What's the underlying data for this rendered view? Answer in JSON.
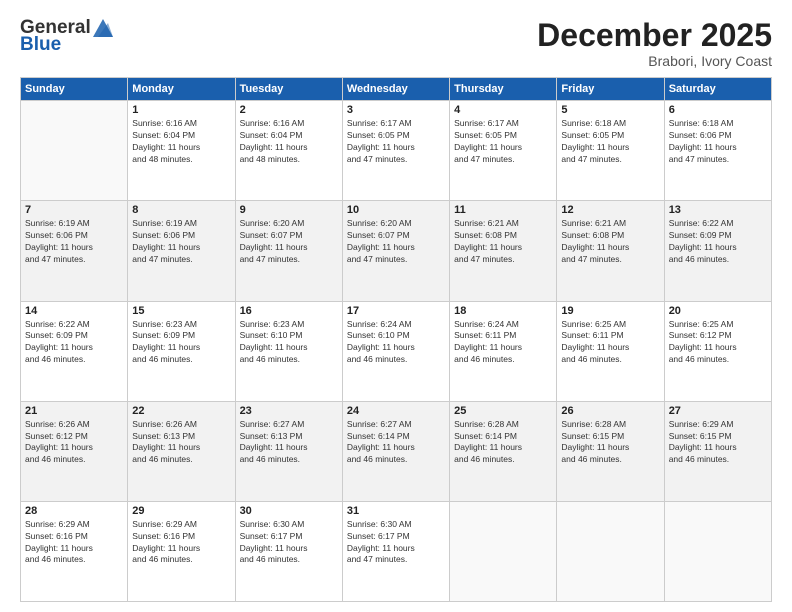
{
  "logo": {
    "general": "General",
    "blue": "Blue"
  },
  "title": "December 2025",
  "location": "Brabori, Ivory Coast",
  "days_of_week": [
    "Sunday",
    "Monday",
    "Tuesday",
    "Wednesday",
    "Thursday",
    "Friday",
    "Saturday"
  ],
  "weeks": [
    [
      {
        "day": "",
        "info": ""
      },
      {
        "day": "1",
        "info": "Sunrise: 6:16 AM\nSunset: 6:04 PM\nDaylight: 11 hours\nand 48 minutes."
      },
      {
        "day": "2",
        "info": "Sunrise: 6:16 AM\nSunset: 6:04 PM\nDaylight: 11 hours\nand 48 minutes."
      },
      {
        "day": "3",
        "info": "Sunrise: 6:17 AM\nSunset: 6:05 PM\nDaylight: 11 hours\nand 47 minutes."
      },
      {
        "day": "4",
        "info": "Sunrise: 6:17 AM\nSunset: 6:05 PM\nDaylight: 11 hours\nand 47 minutes."
      },
      {
        "day": "5",
        "info": "Sunrise: 6:18 AM\nSunset: 6:05 PM\nDaylight: 11 hours\nand 47 minutes."
      },
      {
        "day": "6",
        "info": "Sunrise: 6:18 AM\nSunset: 6:06 PM\nDaylight: 11 hours\nand 47 minutes."
      }
    ],
    [
      {
        "day": "7",
        "info": "Sunrise: 6:19 AM\nSunset: 6:06 PM\nDaylight: 11 hours\nand 47 minutes."
      },
      {
        "day": "8",
        "info": "Sunrise: 6:19 AM\nSunset: 6:06 PM\nDaylight: 11 hours\nand 47 minutes."
      },
      {
        "day": "9",
        "info": "Sunrise: 6:20 AM\nSunset: 6:07 PM\nDaylight: 11 hours\nand 47 minutes."
      },
      {
        "day": "10",
        "info": "Sunrise: 6:20 AM\nSunset: 6:07 PM\nDaylight: 11 hours\nand 47 minutes."
      },
      {
        "day": "11",
        "info": "Sunrise: 6:21 AM\nSunset: 6:08 PM\nDaylight: 11 hours\nand 47 minutes."
      },
      {
        "day": "12",
        "info": "Sunrise: 6:21 AM\nSunset: 6:08 PM\nDaylight: 11 hours\nand 47 minutes."
      },
      {
        "day": "13",
        "info": "Sunrise: 6:22 AM\nSunset: 6:09 PM\nDaylight: 11 hours\nand 46 minutes."
      }
    ],
    [
      {
        "day": "14",
        "info": "Sunrise: 6:22 AM\nSunset: 6:09 PM\nDaylight: 11 hours\nand 46 minutes."
      },
      {
        "day": "15",
        "info": "Sunrise: 6:23 AM\nSunset: 6:09 PM\nDaylight: 11 hours\nand 46 minutes."
      },
      {
        "day": "16",
        "info": "Sunrise: 6:23 AM\nSunset: 6:10 PM\nDaylight: 11 hours\nand 46 minutes."
      },
      {
        "day": "17",
        "info": "Sunrise: 6:24 AM\nSunset: 6:10 PM\nDaylight: 11 hours\nand 46 minutes."
      },
      {
        "day": "18",
        "info": "Sunrise: 6:24 AM\nSunset: 6:11 PM\nDaylight: 11 hours\nand 46 minutes."
      },
      {
        "day": "19",
        "info": "Sunrise: 6:25 AM\nSunset: 6:11 PM\nDaylight: 11 hours\nand 46 minutes."
      },
      {
        "day": "20",
        "info": "Sunrise: 6:25 AM\nSunset: 6:12 PM\nDaylight: 11 hours\nand 46 minutes."
      }
    ],
    [
      {
        "day": "21",
        "info": "Sunrise: 6:26 AM\nSunset: 6:12 PM\nDaylight: 11 hours\nand 46 minutes."
      },
      {
        "day": "22",
        "info": "Sunrise: 6:26 AM\nSunset: 6:13 PM\nDaylight: 11 hours\nand 46 minutes."
      },
      {
        "day": "23",
        "info": "Sunrise: 6:27 AM\nSunset: 6:13 PM\nDaylight: 11 hours\nand 46 minutes."
      },
      {
        "day": "24",
        "info": "Sunrise: 6:27 AM\nSunset: 6:14 PM\nDaylight: 11 hours\nand 46 minutes."
      },
      {
        "day": "25",
        "info": "Sunrise: 6:28 AM\nSunset: 6:14 PM\nDaylight: 11 hours\nand 46 minutes."
      },
      {
        "day": "26",
        "info": "Sunrise: 6:28 AM\nSunset: 6:15 PM\nDaylight: 11 hours\nand 46 minutes."
      },
      {
        "day": "27",
        "info": "Sunrise: 6:29 AM\nSunset: 6:15 PM\nDaylight: 11 hours\nand 46 minutes."
      }
    ],
    [
      {
        "day": "28",
        "info": "Sunrise: 6:29 AM\nSunset: 6:16 PM\nDaylight: 11 hours\nand 46 minutes."
      },
      {
        "day": "29",
        "info": "Sunrise: 6:29 AM\nSunset: 6:16 PM\nDaylight: 11 hours\nand 46 minutes."
      },
      {
        "day": "30",
        "info": "Sunrise: 6:30 AM\nSunset: 6:17 PM\nDaylight: 11 hours\nand 46 minutes."
      },
      {
        "day": "31",
        "info": "Sunrise: 6:30 AM\nSunset: 6:17 PM\nDaylight: 11 hours\nand 47 minutes."
      },
      {
        "day": "",
        "info": ""
      },
      {
        "day": "",
        "info": ""
      },
      {
        "day": "",
        "info": ""
      }
    ]
  ]
}
